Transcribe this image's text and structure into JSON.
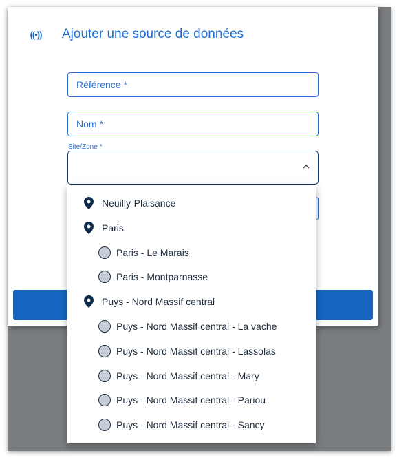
{
  "dialog": {
    "title": "Ajouter une source de données",
    "icon": "broadcast-icon",
    "icon_glyph": "((•))"
  },
  "form": {
    "reference_label": "Référence *",
    "nom_label": "Nom *",
    "site_label": "Site/Zone *"
  },
  "colors": {
    "accent": "#1565c0",
    "title": "#1e6ed1",
    "text": "#1f2d3d",
    "backdrop": "#7a7d80"
  },
  "dropdown": {
    "options": [
      {
        "label": "Neuilly-Plaisance",
        "type": "site"
      },
      {
        "label": "Paris",
        "type": "site"
      },
      {
        "label": "Paris - Le Marais",
        "type": "zone"
      },
      {
        "label": "Paris - Montparnasse",
        "type": "zone"
      },
      {
        "label": "Puys - Nord Massif central",
        "type": "site"
      },
      {
        "label": "Puys - Nord Massif central - La vache",
        "type": "zone"
      },
      {
        "label": "Puys - Nord Massif central - Lassolas",
        "type": "zone"
      },
      {
        "label": "Puys - Nord Massif central - Mary",
        "type": "zone"
      },
      {
        "label": "Puys - Nord Massif central - Pariou",
        "type": "zone"
      },
      {
        "label": "Puys - Nord Massif central - Sancy",
        "type": "zone"
      }
    ]
  }
}
